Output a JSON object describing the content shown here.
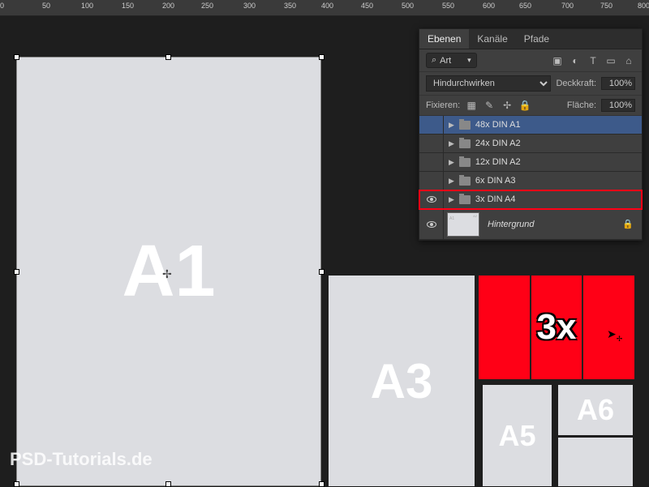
{
  "ruler": {
    "marks": [
      0,
      50,
      100,
      150,
      200,
      250,
      300,
      350,
      400,
      450,
      500,
      550,
      600,
      650,
      700,
      750,
      800
    ]
  },
  "canvas": {
    "a1": "A1",
    "a3": "A3",
    "a5": "A5",
    "a6": "A6",
    "red_label": "3x"
  },
  "watermark": "PSD-Tutorials.de",
  "panel": {
    "tabs": {
      "layers": "Ebenen",
      "channels": "Kanäle",
      "paths": "Pfade"
    },
    "filter": {
      "placeholder": "Art",
      "search_icon": "⌕"
    },
    "blend_mode": "Hindurchwirken",
    "opacity_label": "Deckkraft:",
    "opacity_value": "100%",
    "lock_label": "Fixieren:",
    "fill_label": "Fläche:",
    "fill_value": "100%",
    "layers": [
      {
        "name": "48x DIN A1",
        "visible": false,
        "selected": true
      },
      {
        "name": "24x DIN A2",
        "visible": false
      },
      {
        "name": "12x DIN A2",
        "visible": false
      },
      {
        "name": "6x DIN A3",
        "visible": false
      },
      {
        "name": "3x DIN A4",
        "visible": true,
        "highlighted": true
      }
    ],
    "background": "Hintergrund"
  }
}
